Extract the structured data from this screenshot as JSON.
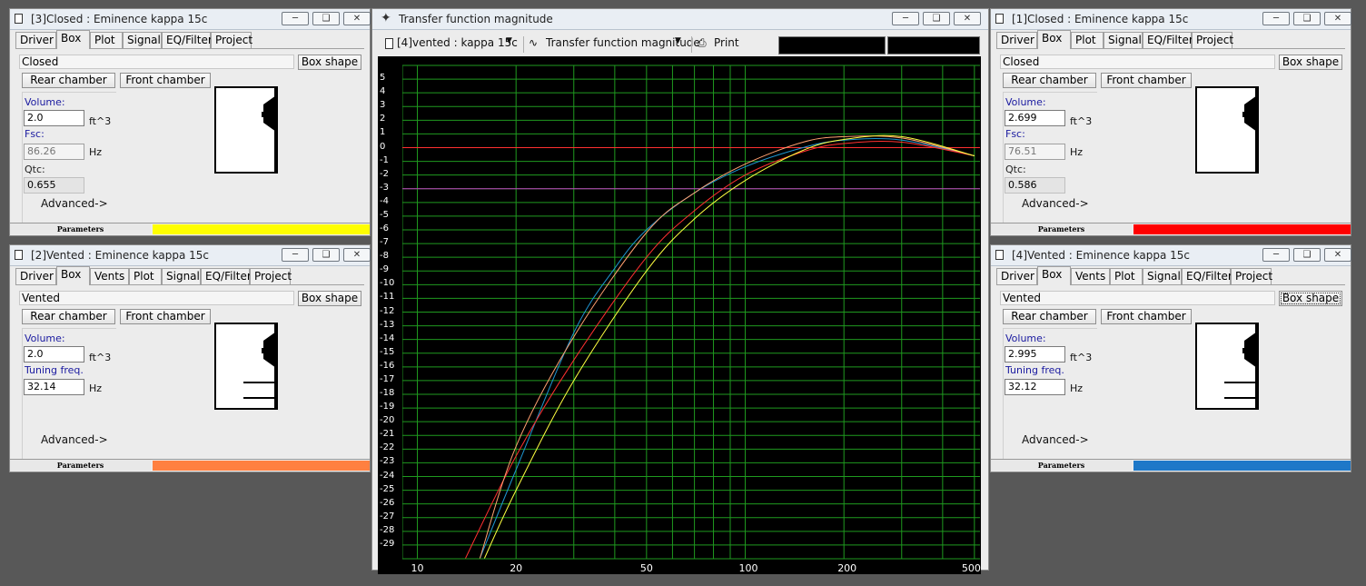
{
  "windows": [
    {
      "id": "w3",
      "title": "[3]Closed : Eminence kappa 15c",
      "tabs": [
        "Driver",
        "Box",
        "Plot",
        "Signal",
        "EQ/Filter",
        "Project"
      ],
      "selected_tab": "Box",
      "box_type": "Closed",
      "box_shape_label": "Box shape",
      "rear_label": "Rear chamber",
      "front_label": "Front chamber",
      "field1_label": "Volume:",
      "field1_value": "2.0",
      "field1_unit": "ft^3",
      "field2_label": "Fsc:",
      "field2_value": "86.26",
      "field2_unit": "Hz",
      "field3_label": "Qtc:",
      "field3_value": "0.655",
      "advanced_label": "Advanced->",
      "params_label": "Parameters",
      "color": "#ffff00"
    },
    {
      "id": "w2",
      "title": "[2]Vented : Eminence kappa 15c",
      "tabs": [
        "Driver",
        "Box",
        "Vents",
        "Plot",
        "Signal",
        "EQ/Filter",
        "Project"
      ],
      "selected_tab": "Box",
      "box_type": "Vented",
      "box_shape_label": "Box shape",
      "rear_label": "Rear chamber",
      "front_label": "Front chamber",
      "field1_label": "Volume:",
      "field1_value": "2.0",
      "field1_unit": "ft^3",
      "field2_label": "Tuning freq.",
      "field2_value": "32.14",
      "field2_unit": "Hz",
      "advanced_label": "Advanced->",
      "params_label": "Parameters",
      "color": "#ff8040"
    },
    {
      "id": "w1",
      "title": "[1]Closed : Eminence kappa 15c",
      "tabs": [
        "Driver",
        "Box",
        "Plot",
        "Signal",
        "EQ/Filter",
        "Project"
      ],
      "selected_tab": "Box",
      "box_type": "Closed",
      "box_shape_label": "Box shape",
      "rear_label": "Rear chamber",
      "front_label": "Front chamber",
      "field1_label": "Volume:",
      "field1_value": "2.699",
      "field1_unit": "ft^3",
      "field2_label": "Fsc:",
      "field2_value": "76.51",
      "field2_unit": "Hz",
      "field3_label": "Qtc:",
      "field3_value": "0.586",
      "advanced_label": "Advanced->",
      "params_label": "Parameters",
      "color": "#ff0000"
    },
    {
      "id": "w4",
      "title": "[4]Vented : Eminence kappa 15c",
      "tabs": [
        "Driver",
        "Box",
        "Vents",
        "Plot",
        "Signal",
        "EQ/Filter",
        "Project"
      ],
      "selected_tab": "Box",
      "box_type": "Vented",
      "box_shape_label": "Box shape",
      "rear_label": "Rear chamber",
      "front_label": "Front chamber",
      "field1_label": "Volume:",
      "field1_value": "2.995",
      "field1_unit": "ft^3",
      "field2_label": "Tuning freq.",
      "field2_value": "32.12",
      "field2_unit": "Hz",
      "advanced_label": "Advanced->",
      "params_label": "Parameters",
      "color": "#1e78c8"
    }
  ],
  "plot_window": {
    "title": "Transfer function magnitude",
    "project_select": "[4]vented : kappa 15c",
    "graph_select": "Transfer function magnitude",
    "print_label": "Print"
  },
  "chart_data": {
    "type": "line",
    "xscale": "log",
    "xlim": [
      9,
      520
    ],
    "ylim": [
      -30,
      6
    ],
    "x_ticks": [
      10,
      20,
      50,
      100,
      200,
      500
    ],
    "y_ticks": [
      5,
      4,
      3,
      2,
      1,
      0,
      -1,
      -2,
      -3,
      -4,
      -5,
      -6,
      -7,
      -8,
      -9,
      -10,
      -11,
      -12,
      -13,
      -14,
      -15,
      -16,
      -17,
      -18,
      -19,
      -20,
      -21,
      -22,
      -23,
      -24,
      -25,
      -26,
      -27,
      -28,
      -29
    ],
    "reference_lines": [
      {
        "y": 0,
        "color": "#ff3030"
      },
      {
        "y": -3,
        "color": "#c040c0"
      }
    ],
    "grid": true,
    "series": [
      {
        "color": "#1e96d2",
        "points": [
          [
            15.5,
            -30
          ],
          [
            20,
            -23.5
          ],
          [
            30,
            -13.5
          ],
          [
            40,
            -8.8
          ],
          [
            50,
            -6
          ],
          [
            70,
            -3.3
          ],
          [
            100,
            -1.4
          ],
          [
            150,
            0
          ],
          [
            200,
            0.55
          ],
          [
            300,
            0.55
          ],
          [
            500,
            -0.6
          ]
        ]
      },
      {
        "color": "#ff3030",
        "points": [
          [
            14,
            -30
          ],
          [
            20,
            -22.5
          ],
          [
            30,
            -15.5
          ],
          [
            50,
            -8
          ],
          [
            70,
            -4.6
          ],
          [
            100,
            -2
          ],
          [
            150,
            -0.3
          ],
          [
            200,
            0.3
          ],
          [
            300,
            0.4
          ],
          [
            500,
            -0.6
          ]
        ]
      },
      {
        "color": "#ffa070",
        "points": [
          [
            15.5,
            -30
          ],
          [
            20,
            -21.8
          ],
          [
            30,
            -13.8
          ],
          [
            50,
            -6.2
          ],
          [
            70,
            -3.3
          ],
          [
            100,
            -1.2
          ],
          [
            150,
            0.4
          ],
          [
            200,
            0.8
          ],
          [
            300,
            0.7
          ],
          [
            500,
            -0.6
          ]
        ]
      },
      {
        "color": "#ffff40",
        "points": [
          [
            16,
            -30
          ],
          [
            20,
            -25
          ],
          [
            30,
            -17
          ],
          [
            50,
            -9
          ],
          [
            70,
            -5.2
          ],
          [
            100,
            -2.4
          ],
          [
            150,
            -0.2
          ],
          [
            200,
            0.6
          ],
          [
            300,
            0.8
          ],
          [
            500,
            -0.6
          ]
        ]
      }
    ]
  }
}
